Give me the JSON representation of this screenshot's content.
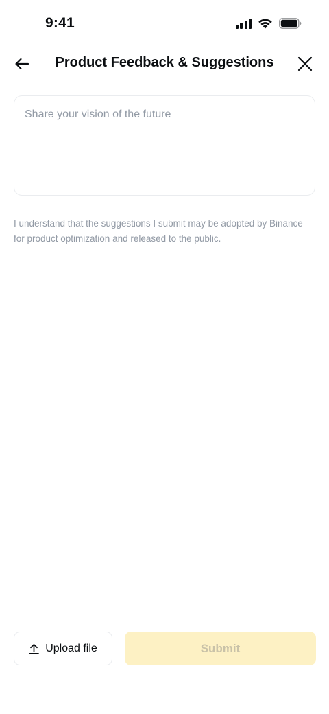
{
  "status_bar": {
    "time": "9:41",
    "icons": [
      "signal-icon",
      "wifi-icon",
      "battery-icon"
    ]
  },
  "header": {
    "back_icon": "arrow-left-icon",
    "title": "Product Feedback & Suggestions",
    "close_icon": "close-icon"
  },
  "form": {
    "feedback_value": "",
    "feedback_placeholder": "Share your vision of the future",
    "disclaimer": "I understand that the suggestions I submit may be adopted by Binance for product optimization and released to the public."
  },
  "actions": {
    "upload_icon": "upload-icon",
    "upload_label": "Upload file",
    "submit_label": "Submit",
    "submit_enabled": false
  },
  "colors": {
    "text_primary": "#0b0e11",
    "text_secondary": "#929aa5",
    "border": "#eaecef",
    "submit_disabled_bg": "#fdf1c4",
    "submit_disabled_text": "#c9c2a8"
  }
}
